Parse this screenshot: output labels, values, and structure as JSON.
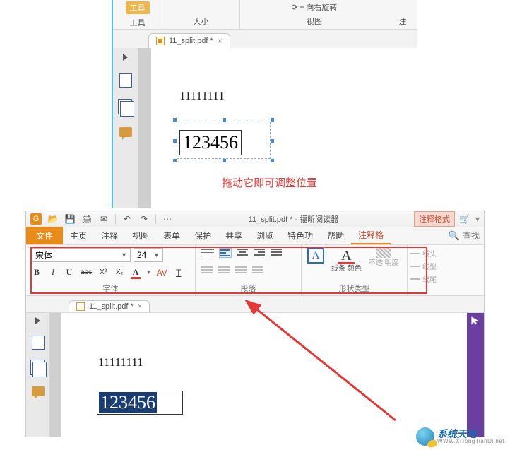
{
  "top": {
    "ribbon": {
      "tool_badge": "工具",
      "tool_label": "工具",
      "size_label": "大小",
      "rotate_label": "向右旋转",
      "view_label": "视图",
      "comment_label": "注"
    },
    "tab": {
      "filename": "11_split.pdf *"
    },
    "page": {
      "line1": "11111111",
      "boxed": "123456",
      "hint": "拖动它即可调整位置"
    }
  },
  "bottom": {
    "title": "11_split.pdf * - 福昕阅读器",
    "right_tab": "注释格式",
    "menu": {
      "file": "文件",
      "items": [
        "主页",
        "注释",
        "视图",
        "表单",
        "保护",
        "共享",
        "浏览",
        "特色功",
        "帮助"
      ],
      "active": "注释格",
      "search_placeholder": "查找"
    },
    "toolbar": {
      "font_name": "宋体",
      "font_size": "24",
      "group_font": "字体",
      "group_para": "段落",
      "group_shape": "形状类型",
      "line_color": "线条\n颜色",
      "opacity": "不透\n明度",
      "line_head": "线头",
      "line_style": "线型",
      "line_tail": "线尾"
    },
    "tab": {
      "filename": "11_split.pdf *"
    },
    "page": {
      "line1": "11111111",
      "boxed": "123456"
    }
  },
  "watermark": {
    "cn": "系统天地",
    "en": "WWW.XiTongTianDi.net"
  }
}
